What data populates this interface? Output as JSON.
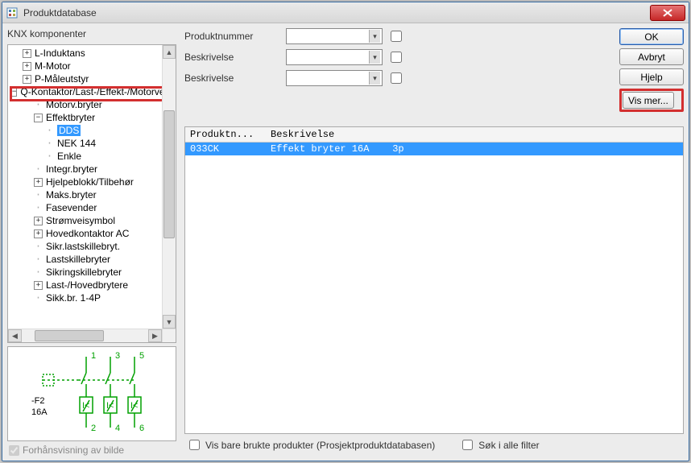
{
  "window": {
    "title": "Produktdatabase"
  },
  "left": {
    "header": "KNX komponenter",
    "tree": {
      "l": "L-Induktans",
      "m": "M-Motor",
      "p": "P-Måleutstyr",
      "q": "Q-Kontaktor/Last-/Effekt-/Motorve",
      "motorv": "Motorv.bryter",
      "effektbryter": "Effektbryter",
      "dds": "DDS",
      "nek": "NEK 144",
      "enkle": "Enkle",
      "integr": "Integr.bryter",
      "hjelpeblokk": "Hjelpeblokk/Tilbehør",
      "maks": "Maks.bryter",
      "fasevender": "Fasevender",
      "stromvei": "Strømveisymbol",
      "hovedkontaktor": "Hovedkontaktor AC",
      "sikrlast": "Sikr.lastskillebryt.",
      "lastskille": "Lastskillebryter",
      "sikring": "Sikringskillebryter",
      "lasthoved": "Last-/Hovedbrytere",
      "sikkbr": "Sikk.br. 1-4P"
    },
    "preview": {
      "labels": {
        "top1": "1",
        "top3": "3",
        "top5": "5",
        "bot2": "2",
        "bot4": "4",
        "bot6": "6",
        "f2": "-F2",
        "amp": "16A"
      }
    },
    "preview_check": "Forhånsvisning av bilde"
  },
  "form": {
    "produktnummer": "Produktnummer",
    "beskrivelse1": "Beskrivelse",
    "beskrivelse2": "Beskrivelse"
  },
  "buttons": {
    "ok": "OK",
    "avbryt": "Avbryt",
    "hjelp": "Hjelp",
    "vismer": "Vis mer..."
  },
  "table": {
    "col_prod": "Produktn...",
    "col_desc": "Beskrivelse",
    "rows": [
      {
        "prod": "033CK",
        "desc": "Effekt bryter 16A    3p"
      }
    ]
  },
  "bottom": {
    "brukte": "Vis bare brukte produkter (Prosjektproduktdatabasen)",
    "sok": "Søk i alle filter"
  }
}
